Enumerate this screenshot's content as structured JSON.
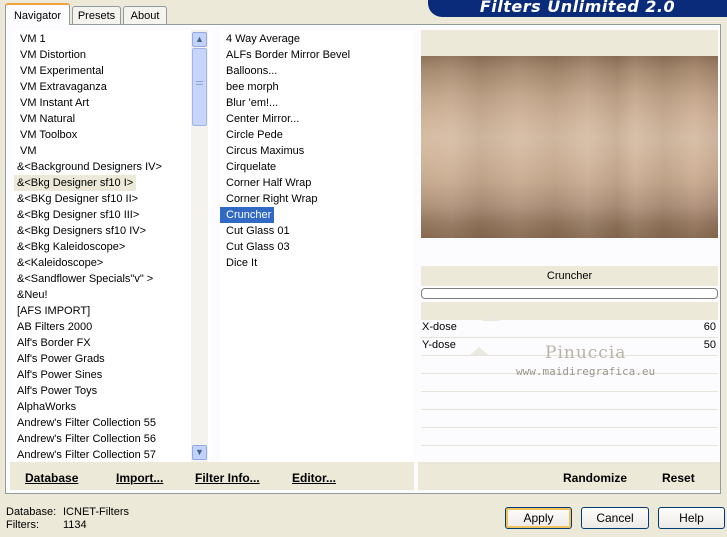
{
  "banner": {
    "title": "Filters Unlimited 2.0"
  },
  "tabs": [
    {
      "label": "Navigator",
      "active": true
    },
    {
      "label": "Presets",
      "active": false
    },
    {
      "label": "About",
      "active": false
    }
  ],
  "categories": [
    "VM 1",
    "VM Distortion",
    "VM Experimental",
    "VM Extravaganza",
    "VM Instant Art",
    "VM Natural",
    "VM Toolbox",
    "VM",
    "&<Background Designers IV>",
    "&<Bkg Designer sf10 I>",
    "&<BKg Designer sf10 II>",
    "&<Bkg Designer sf10 III>",
    "&<Bkg Designers sf10 IV>",
    "&<Bkg Kaleidoscope>",
    "&<Kaleidoscope>",
    "&<Sandflower Specials\"v\" >",
    "&Neu!",
    "[AFS IMPORT]",
    "AB Filters 2000",
    "Alf's Border FX",
    "Alf's Power Grads",
    "Alf's Power Sines",
    "Alf's Power Toys",
    "AlphaWorks",
    "Andrew's Filter Collection 55",
    "Andrew's Filter Collection 56",
    "Andrew's Filter Collection 57"
  ],
  "filters": [
    "4 Way Average",
    "ALFs Border Mirror Bevel",
    "Balloons...",
    "bee morph",
    "Blur 'em!...",
    "Center Mirror...",
    "Circle Pede",
    "Circus Maximus",
    "Cirquelate",
    "Corner Half Wrap",
    "Corner Right Wrap",
    "Cruncher",
    "Cut Glass 01",
    "Cut Glass 03",
    "Dice It"
  ],
  "toolbar_left": {
    "database": "Database",
    "import": "Import...",
    "filter_info": "Filter Info...",
    "editor": "Editor..."
  },
  "toolbar_right": {
    "randomize": "Randomize",
    "reset": "Reset"
  },
  "filter_name": "Cruncher",
  "sliders": [
    {
      "label": "X-dose",
      "value": "60",
      "fraction": 0.235
    },
    {
      "label": "Y-dose",
      "value": "50",
      "fraction": 0.196
    }
  ],
  "watermark": {
    "name": "Pinuccia",
    "url": "www.maidiregrafica.eu"
  },
  "status": {
    "database_label": "Database:",
    "database_value": "ICNET-Filters",
    "filters_label": "Filters:",
    "filters_value": "1134"
  },
  "buttons": {
    "apply": "Apply",
    "cancel": "Cancel",
    "help": "Help"
  }
}
